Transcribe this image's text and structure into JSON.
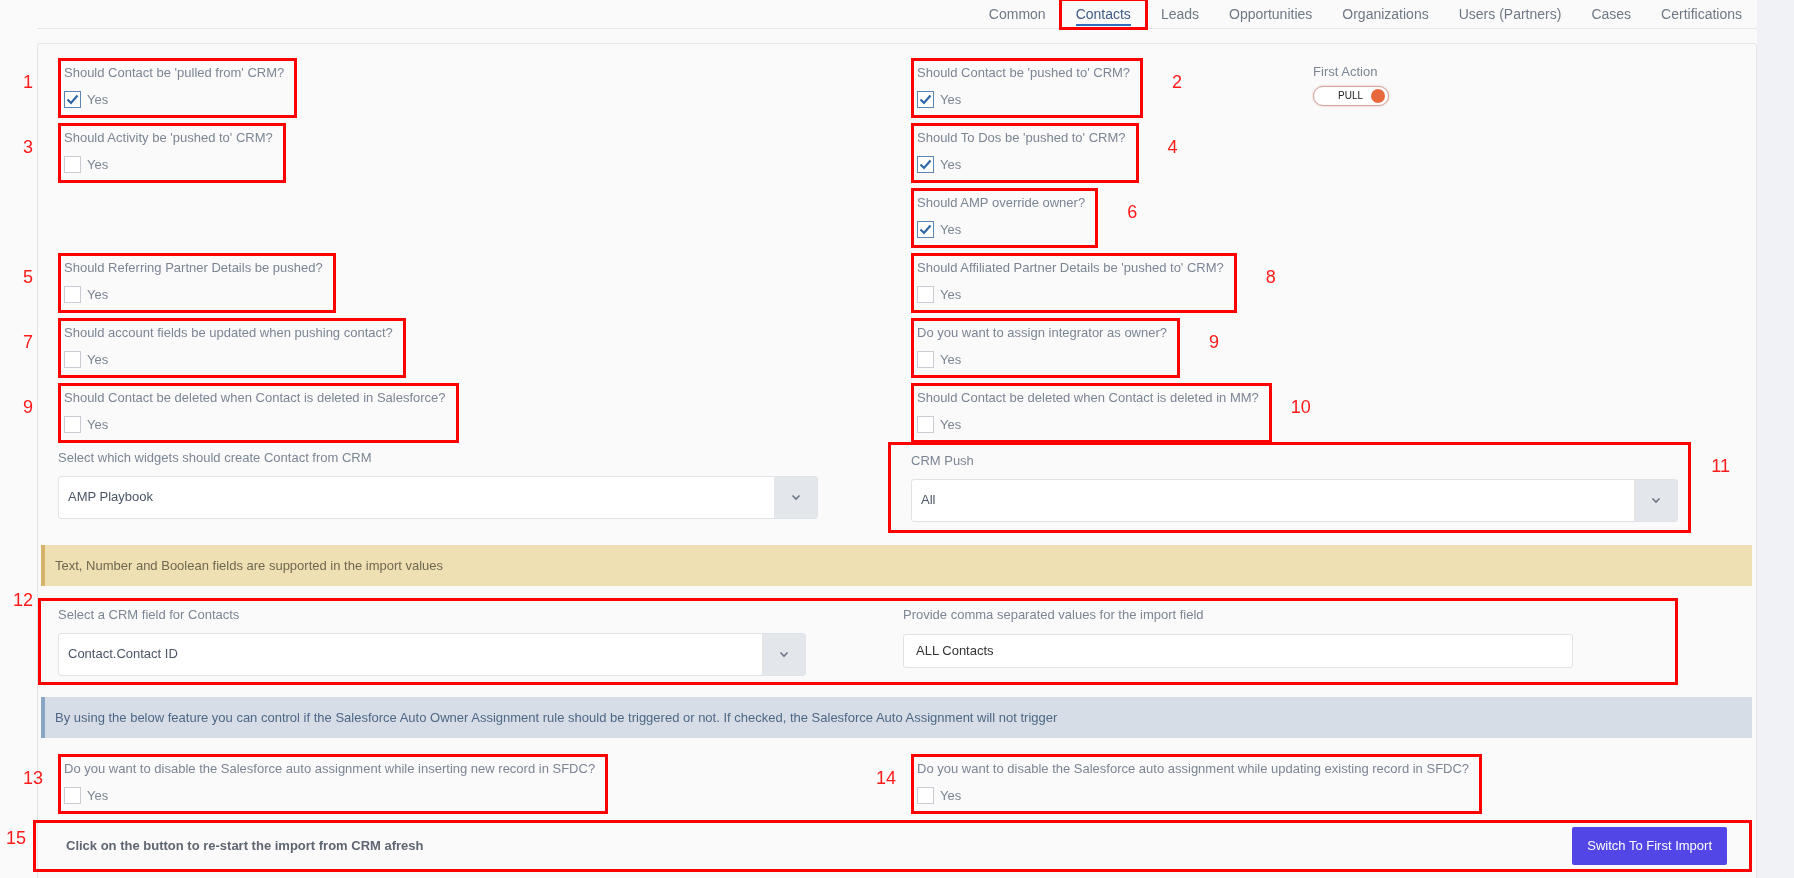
{
  "tabs": [
    {
      "label": "Common",
      "selected": false,
      "annotated": false
    },
    {
      "label": "Contacts",
      "selected": true,
      "annotated": true
    },
    {
      "label": "Leads",
      "selected": false,
      "annotated": false
    },
    {
      "label": "Opportunities",
      "selected": false,
      "annotated": false
    },
    {
      "label": "Organizations",
      "selected": false,
      "annotated": false
    },
    {
      "label": "Users (Partners)",
      "selected": false,
      "annotated": false
    },
    {
      "label": "Cases",
      "selected": false,
      "annotated": false
    },
    {
      "label": "Certifications",
      "selected": false,
      "annotated": false
    }
  ],
  "first_action": {
    "label": "First Action",
    "value": "PULL",
    "on": true
  },
  "setting_rows": [
    {
      "left": {
        "annotation": "1",
        "label": "Should Contact be 'pulled from' CRM?",
        "option": "Yes",
        "checked": true
      },
      "right": {
        "annotation": "2",
        "label": "Should Contact be 'pushed to' CRM?",
        "option": "Yes",
        "checked": true
      }
    },
    {
      "left": {
        "annotation": "3",
        "label": "Should Activity be 'pushed to' CRM?",
        "option": "Yes",
        "checked": false
      },
      "right": {
        "annotation": "4",
        "label": "Should To Dos be 'pushed to' CRM?",
        "option": "Yes",
        "checked": true
      }
    },
    {
      "right": {
        "annotation": "6",
        "label": "Should AMP override owner?",
        "option": "Yes",
        "checked": true
      }
    },
    {
      "left": {
        "annotation": "5",
        "label": "Should Referring Partner Details be pushed?",
        "option": "Yes",
        "checked": false
      },
      "right": {
        "annotation": "8",
        "label": "Should Affiliated Partner Details be 'pushed to' CRM?",
        "option": "Yes",
        "checked": false
      }
    },
    {
      "left": {
        "annotation": "7",
        "label": "Should account fields be updated when pushing contact?",
        "option": "Yes",
        "checked": false
      },
      "right": {
        "annotation": "9",
        "label": "Do you want to assign integrator as owner?",
        "option": "Yes",
        "checked": false
      }
    },
    {
      "left": {
        "annotation": "9",
        "label": "Should Contact be deleted when Contact is deleted in Salesforce?",
        "option": "Yes",
        "checked": false
      },
      "right": {
        "annotation": "10",
        "label": "Should Contact be deleted when Contact is deleted in MM?",
        "option": "Yes",
        "checked": false
      }
    }
  ],
  "widget_selects": {
    "left": {
      "label": "Select which widgets should create Contact from CRM",
      "value": "AMP Playbook"
    },
    "right": {
      "annotation": "11",
      "label": "CRM Push",
      "value": "All"
    }
  },
  "import_note": "Text, Number and Boolean fields are supported in the import values",
  "import_fields": {
    "annotation": "12",
    "crm_field": {
      "label": "Select a CRM field for Contacts",
      "value": "Contact.Contact ID"
    },
    "values_field": {
      "label": "Provide comma separated values for the import field",
      "value": "ALL Contacts"
    }
  },
  "assignment_note": "By using the below feature you can control if the Salesforce Auto Owner Assignment rule should be triggered or not. If checked, the Salesforce Auto Assignment will not trigger",
  "assignment_settings": [
    {
      "annotation": "13",
      "label": "Do you want to disable the Salesforce auto assignment while inserting new record in SFDC?",
      "option": "Yes",
      "checked": false
    },
    {
      "annotation": "14",
      "label": "Do you want to disable the Salesforce auto assignment while updating existing record in SFDC?",
      "option": "Yes",
      "checked": false
    }
  ],
  "restart": {
    "annotation": "15",
    "text": "Click on the button to re-start the import from CRM afresh",
    "button": "Switch To First Import"
  }
}
